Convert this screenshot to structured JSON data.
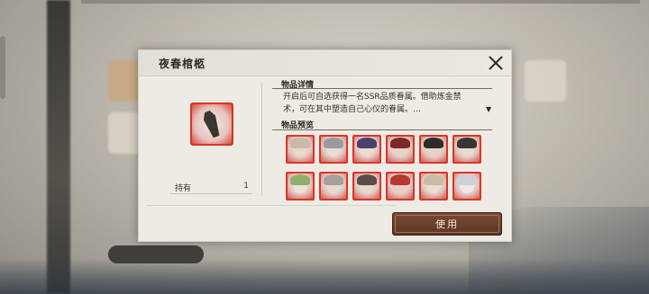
{
  "dialog": {
    "title": "夜春棺柩",
    "details_heading": "物品详情",
    "description_line1": "开启后可自选获得一名SSR品质眷属。借助炼金禁",
    "description_line2": "术，可在其中塑造自己心仪的眷属。…",
    "expand_arrow": "▼",
    "preview_heading": "物品预览",
    "hold_label": "持有",
    "hold_count": "1",
    "use_button": "使用"
  },
  "portraits": [
    {
      "hair": "#c9b9a8",
      "face": "#e9d8cc"
    },
    {
      "hair": "#9a9a9e",
      "face": "#e6ddd6"
    },
    {
      "hair": "#4a3f6d",
      "face": "#eddcd2"
    },
    {
      "hair": "#7a2a28",
      "face": "#e9d2c7"
    },
    {
      "hair": "#2f2b29",
      "face": "#e5d3c8"
    },
    {
      "hair": "#3a3532",
      "face": "#e8d9ce"
    },
    {
      "hair": "#8fae6a",
      "face": "#efe2d6"
    },
    {
      "hair": "#a89f9a",
      "face": "#e7dad0"
    },
    {
      "hair": "#5a4d47",
      "face": "#ead7cb"
    },
    {
      "hair": "#b53a33",
      "face": "#e8cfc4"
    },
    {
      "hair": "#c8bca4",
      "face": "#ebddd1"
    },
    {
      "hair": "#cfd0d6",
      "face": "#f0e7e2"
    }
  ],
  "colors": {
    "rarity_border": "#d8372c",
    "button": "#6a3f2c"
  }
}
